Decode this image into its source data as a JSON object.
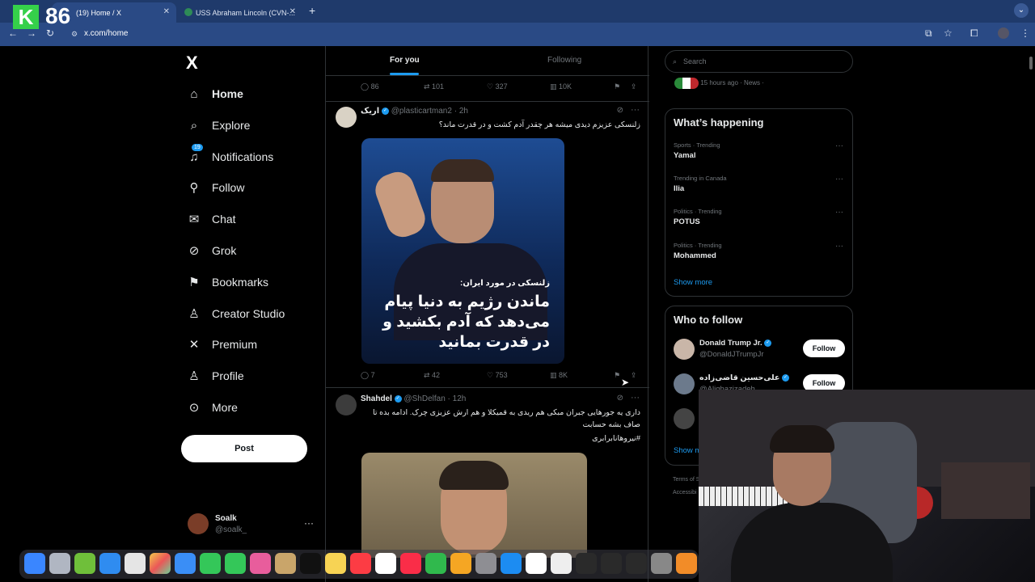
{
  "browser": {
    "tabs": [
      {
        "label": "(19) Home / X",
        "active": true
      },
      {
        "label": "USS Abraham Lincoln (CVN-...",
        "active": false
      }
    ],
    "new_tab": "+",
    "url": "x.com/home",
    "overlay_logo": "K",
    "overlay_number": "86"
  },
  "sidebar": {
    "logo": "X",
    "items": [
      {
        "label": "Home",
        "icon": "home-icon"
      },
      {
        "label": "Explore",
        "icon": "search-icon"
      },
      {
        "label": "Notifications",
        "icon": "bell-icon",
        "badge": "19"
      },
      {
        "label": "Follow",
        "icon": "person-add-icon"
      },
      {
        "label": "Chat",
        "icon": "mail-icon"
      },
      {
        "label": "Grok",
        "icon": "grok-icon"
      },
      {
        "label": "Bookmarks",
        "icon": "bookmark-icon"
      },
      {
        "label": "Creator Studio",
        "icon": "creator-icon"
      },
      {
        "label": "Premium",
        "icon": "x-icon"
      },
      {
        "label": "Profile",
        "icon": "person-icon"
      },
      {
        "label": "More",
        "icon": "more-circle-icon"
      }
    ],
    "post_label": "Post",
    "account": {
      "name": "Soalk",
      "handle": "@soalk_",
      "more": "···"
    }
  },
  "feed": {
    "tabs": {
      "for_you": "For you",
      "following": "Following"
    },
    "prev_actions": {
      "replies": "86",
      "reposts": "101",
      "likes": "327",
      "views": "10K"
    },
    "tweet1": {
      "name": "اریک",
      "handle": "@plasticartman2",
      "time": "· 2h",
      "text": "زلنسکی عزیزم دیدی میشه هر چقدر آدم کشت و در قدرت ماند؟",
      "image_caption_small": "زلنسکی در مورد ایران:",
      "image_caption_large": "ماندن رژیم به دنیا پیام می‌دهد که آدم بکشید و در قدرت بمانید",
      "actions": {
        "replies": "7",
        "reposts": "42",
        "likes": "753",
        "views": "8K"
      }
    },
    "tweet2": {
      "name": "Shahdel",
      "handle": "@ShDelfan",
      "time": "· 12h",
      "text": "داری یه جورهایی جبران مبکی هم ریدی به قمیکلا و هم ارش عزیزی چرک. ادامه بده تا صاف بشه حسابت",
      "hashtag": "#نیروهانابرابری"
    }
  },
  "right": {
    "search_placeholder": "Search",
    "news_meta": "15 hours ago · News ·",
    "whats_happening": {
      "title": "What’s happening",
      "trends": [
        {
          "meta": "Sports · Trending",
          "topic": "Yamal"
        },
        {
          "meta": "Trending in Canada",
          "topic": "Ilia"
        },
        {
          "meta": "Politics · Trending",
          "topic": "POTUS"
        },
        {
          "meta": "Politics · Trending",
          "topic": "Mohammed"
        }
      ],
      "show_more": "Show more"
    },
    "who_to_follow": {
      "title": "Who to follow",
      "users": [
        {
          "name": "Donald Trump Jr.",
          "handle": "@DonaldJTrumpJr",
          "button": "Follow"
        },
        {
          "name": "علی‌حسین قاضی‌زاده",
          "handle": "@Alighazizadeh",
          "button": "Follow"
        }
      ],
      "show_more": "Show m"
    },
    "footer": {
      "line1": "Terms of S",
      "line2": "Accessibi"
    }
  },
  "colors": {
    "accent": "#1d9bf0",
    "background": "#000000",
    "border": "#2f3336",
    "muted": "#71767b",
    "browser_chrome": "#2a4a85"
  }
}
